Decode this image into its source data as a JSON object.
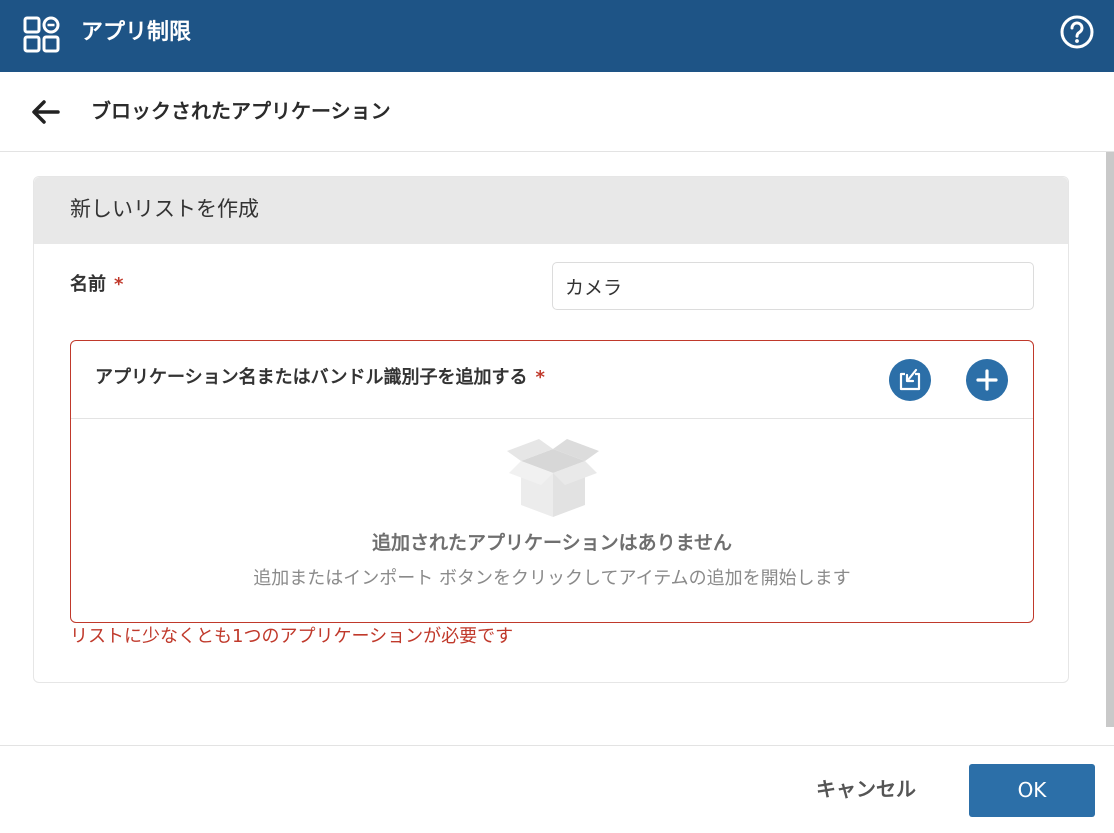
{
  "header": {
    "title": "アプリ制限",
    "app_icon": "apps-grid-icon",
    "help_icon": "help-circle-icon"
  },
  "subheader": {
    "back_icon": "arrow-left-icon",
    "title": "ブロックされたアプリケーション"
  },
  "card": {
    "title": "新しいリストを作成",
    "name_label": "名前",
    "required_marker": "*",
    "name_value": "カメラ",
    "apps": {
      "title": "アプリケーション名またはバンドル識別子を追加する",
      "required_marker": "*",
      "import_icon": "import-icon",
      "add_icon": "plus-icon",
      "empty_icon": "empty-box-icon",
      "empty_title": "追加されたアプリケーションはありません",
      "empty_desc": "追加またはインポート ボタンをクリックしてアイテムの追加を開始します"
    },
    "error": "リストに少なくとも1つのアプリケーションが必要です"
  },
  "footer": {
    "cancel_label": "キャンセル",
    "ok_label": "OK"
  },
  "colors": {
    "header_bg": "#1e5486",
    "primary": "#2c6fa8",
    "error": "#c0392b"
  }
}
